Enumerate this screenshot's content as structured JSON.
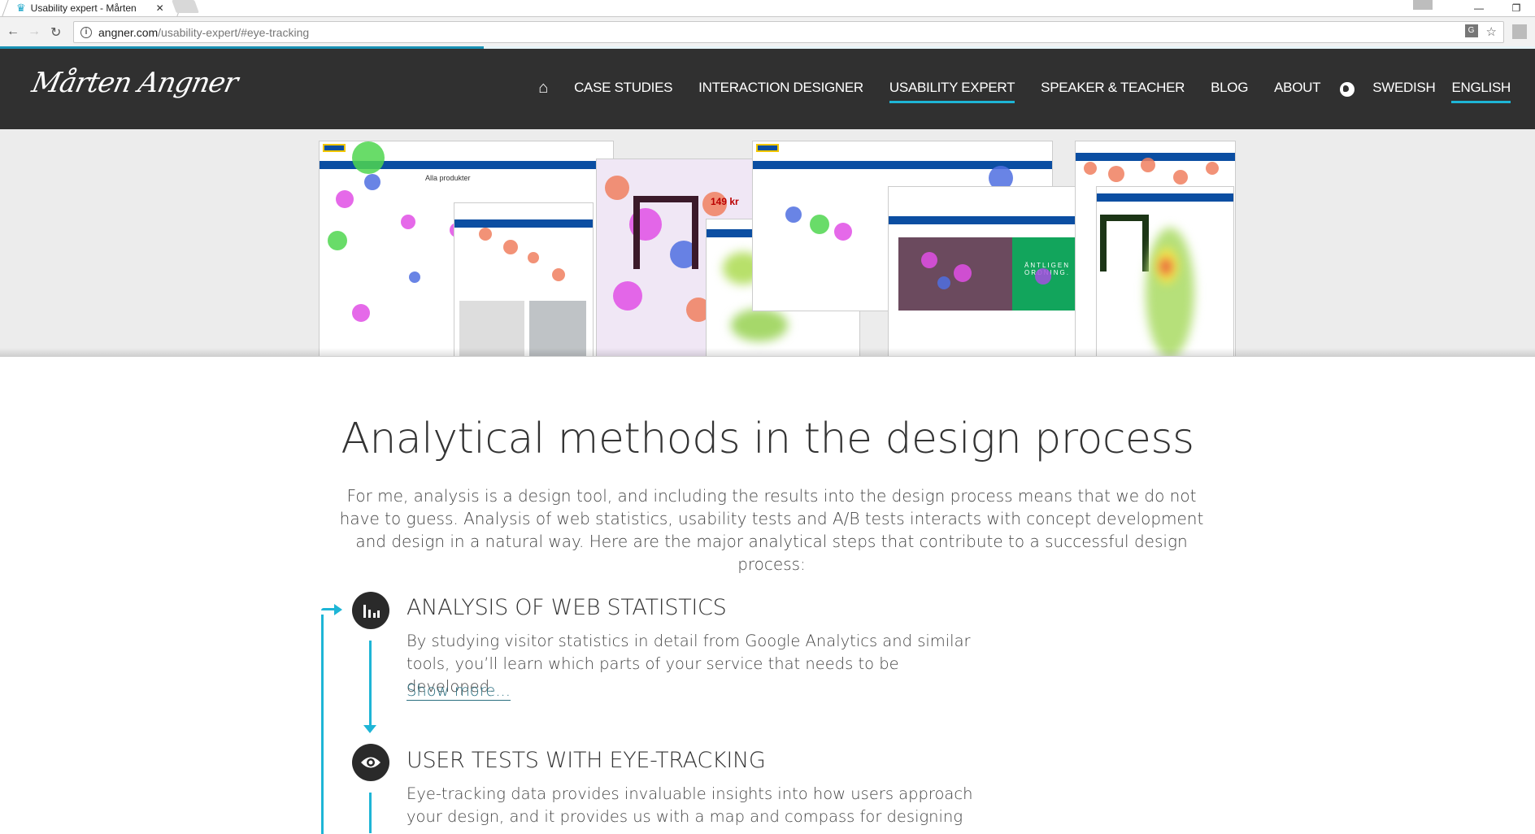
{
  "browser": {
    "tab_title": "Usability expert - Mårten",
    "url_host": "angner.com",
    "url_path": "/usability-expert/#eye-tracking",
    "load_progress_percent": 31.5
  },
  "header": {
    "logo_text": "Mårten Angner",
    "nav": [
      {
        "label": "CASE STUDIES",
        "active": false
      },
      {
        "label": "INTERACTION DESIGNER",
        "active": false
      },
      {
        "label": "USABILITY EXPERT",
        "active": true
      },
      {
        "label": "SPEAKER & TEACHER",
        "active": false
      },
      {
        "label": "BLOG",
        "active": false
      },
      {
        "label": "ABOUT",
        "active": false
      }
    ],
    "lang": [
      {
        "label": "SWEDISH",
        "active": false
      },
      {
        "label": "ENGLISH",
        "active": true
      }
    ]
  },
  "hero": {
    "alt": "Collage of IKEA web page eye-tracking gaze plots and heatmaps",
    "texts": {
      "all_products": "Alla produkter",
      "price": "149 kr",
      "campaign": "ÄNTLIGEN ORDNING."
    }
  },
  "content": {
    "title": "Analytical methods in the design process",
    "intro": "For me, analysis is a design tool, and including the results into the design process means that we do not have to guess. Analysis of web statistics, usability tests and A/B tests interacts with concept development and design in a natural way. Here are the major analytical steps that contribute to a successful design process:",
    "steps": [
      {
        "icon": "bar-chart-icon",
        "title": "ANALYSIS OF WEB STATISTICS",
        "text": "By studying visitor statistics in detail from Google Analytics and similar tools, you’ll learn which parts of your service that needs to be developed.",
        "link": "Show more..."
      },
      {
        "icon": "eye-icon",
        "title": "USER TESTS WITH EYE-TRACKING",
        "text": "Eye-tracking data provides invaluable insights into how users approach your design, and it provides us with a map and compass for designing"
      }
    ]
  },
  "colors": {
    "accent": "#1eb5d6",
    "header_bg": "#303030",
    "link": "#2a6f80"
  }
}
